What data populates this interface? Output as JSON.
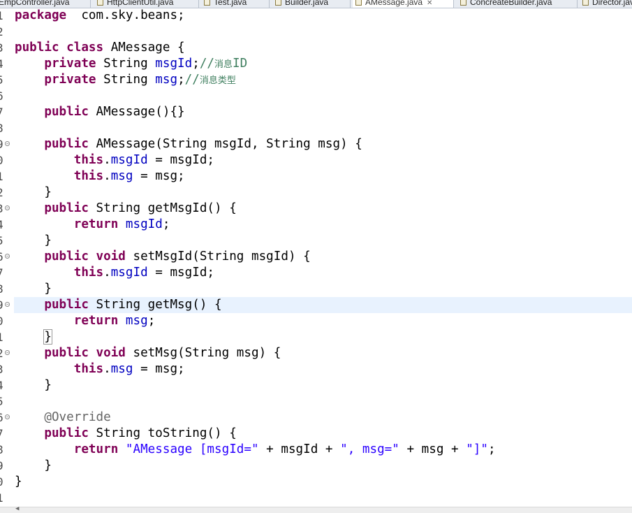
{
  "tabs": [
    {
      "label": "EmpController.java",
      "active": false
    },
    {
      "label": "HttpClientUtil.java",
      "active": false
    },
    {
      "label": "Test.java",
      "active": false
    },
    {
      "label": "Builder.java",
      "active": false
    },
    {
      "label": "AMessage.java",
      "active": true
    },
    {
      "label": "ConcreateBuilder.java",
      "active": false
    },
    {
      "label": "Director.java",
      "active": false
    }
  ],
  "editor": {
    "current_line": 19,
    "lines": [
      {
        "n": "1",
        "fold": "",
        "tokens": [
          [
            "kw",
            "package"
          ],
          [
            "",
            "  com.sky.beans;"
          ]
        ]
      },
      {
        "n": "2",
        "fold": "",
        "tokens": []
      },
      {
        "n": "3",
        "fold": "",
        "tokens": [
          [
            "kw",
            "public"
          ],
          [
            "",
            " "
          ],
          [
            "kw",
            "class"
          ],
          [
            "",
            " AMessage {"
          ]
        ]
      },
      {
        "n": "4",
        "fold": "",
        "tokens": [
          [
            "",
            "    "
          ],
          [
            "kw",
            "private"
          ],
          [
            "",
            " String "
          ],
          [
            "fld",
            "msgId"
          ],
          [
            "",
            ";"
          ],
          [
            "cmt",
            "//"
          ],
          [
            "cmt cjk",
            "消息"
          ],
          [
            "cmt",
            "ID"
          ]
        ]
      },
      {
        "n": "5",
        "fold": "",
        "tokens": [
          [
            "",
            "    "
          ],
          [
            "kw",
            "private"
          ],
          [
            "",
            " String "
          ],
          [
            "fld",
            "msg"
          ],
          [
            "",
            ";"
          ],
          [
            "cmt",
            "//"
          ],
          [
            "cmt cjk",
            "消息类型"
          ]
        ]
      },
      {
        "n": "6",
        "fold": "",
        "tokens": []
      },
      {
        "n": "7",
        "fold": "",
        "tokens": [
          [
            "",
            "    "
          ],
          [
            "kw",
            "public"
          ],
          [
            "",
            " AMessage(){}"
          ]
        ]
      },
      {
        "n": "8",
        "fold": "",
        "tokens": []
      },
      {
        "n": "9",
        "fold": "⊖",
        "tokens": [
          [
            "",
            "    "
          ],
          [
            "kw",
            "public"
          ],
          [
            "",
            " AMessage(String msgId, String msg) {"
          ]
        ]
      },
      {
        "n": "0",
        "fold": "",
        "tokens": [
          [
            "",
            "        "
          ],
          [
            "kw",
            "this"
          ],
          [
            "",
            "."
          ],
          [
            "fld",
            "msgId"
          ],
          [
            "",
            " = msgId;"
          ]
        ]
      },
      {
        "n": "1",
        "fold": "",
        "tokens": [
          [
            "",
            "        "
          ],
          [
            "kw",
            "this"
          ],
          [
            "",
            "."
          ],
          [
            "fld",
            "msg"
          ],
          [
            "",
            " = msg;"
          ]
        ]
      },
      {
        "n": "2",
        "fold": "",
        "tokens": [
          [
            "",
            "    }"
          ]
        ]
      },
      {
        "n": "3",
        "fold": "⊖",
        "tokens": [
          [
            "",
            "    "
          ],
          [
            "kw",
            "public"
          ],
          [
            "",
            " String getMsgId() {"
          ]
        ]
      },
      {
        "n": "4",
        "fold": "",
        "tokens": [
          [
            "",
            "        "
          ],
          [
            "kw",
            "return"
          ],
          [
            "",
            " "
          ],
          [
            "fld",
            "msgId"
          ],
          [
            "",
            ";"
          ]
        ]
      },
      {
        "n": "5",
        "fold": "",
        "tokens": [
          [
            "",
            "    }"
          ]
        ]
      },
      {
        "n": "6",
        "fold": "⊖",
        "tokens": [
          [
            "",
            "    "
          ],
          [
            "kw",
            "public"
          ],
          [
            "",
            " "
          ],
          [
            "kw",
            "void"
          ],
          [
            "",
            " setMsgId(String msgId) {"
          ]
        ]
      },
      {
        "n": "7",
        "fold": "",
        "tokens": [
          [
            "",
            "        "
          ],
          [
            "kw",
            "this"
          ],
          [
            "",
            "."
          ],
          [
            "fld",
            "msgId"
          ],
          [
            "",
            " = msgId;"
          ]
        ]
      },
      {
        "n": "8",
        "fold": "",
        "tokens": [
          [
            "",
            "    }"
          ]
        ]
      },
      {
        "n": "9",
        "fold": "⊖",
        "tokens": [
          [
            "",
            "    "
          ],
          [
            "kw",
            "public"
          ],
          [
            "",
            " String getMsg() {"
          ]
        ]
      },
      {
        "n": "0",
        "fold": "",
        "tokens": [
          [
            "",
            "        "
          ],
          [
            "kw",
            "return"
          ],
          [
            "",
            " "
          ],
          [
            "fld",
            "msg"
          ],
          [
            "",
            ";"
          ]
        ]
      },
      {
        "n": "1",
        "fold": "",
        "tokens": [
          [
            "",
            "    "
          ],
          [
            "brk",
            "}"
          ]
        ]
      },
      {
        "n": "2",
        "fold": "⊖",
        "tokens": [
          [
            "",
            "    "
          ],
          [
            "kw",
            "public"
          ],
          [
            "",
            " "
          ],
          [
            "kw",
            "void"
          ],
          [
            "",
            " setMsg(String msg) {"
          ]
        ]
      },
      {
        "n": "3",
        "fold": "",
        "tokens": [
          [
            "",
            "        "
          ],
          [
            "kw",
            "this"
          ],
          [
            "",
            "."
          ],
          [
            "fld",
            "msg"
          ],
          [
            "",
            " = msg;"
          ]
        ]
      },
      {
        "n": "4",
        "fold": "",
        "tokens": [
          [
            "",
            "    }"
          ]
        ]
      },
      {
        "n": "5",
        "fold": "",
        "tokens": []
      },
      {
        "n": "6",
        "fold": "⊖",
        "tokens": [
          [
            "",
            "    "
          ],
          [
            "ann",
            "@Override"
          ]
        ]
      },
      {
        "n": "7",
        "fold": "",
        "tokens": [
          [
            "",
            "    "
          ],
          [
            "kw",
            "public"
          ],
          [
            "",
            " String toString() {"
          ]
        ]
      },
      {
        "n": "8",
        "fold": "",
        "tokens": [
          [
            "",
            "        "
          ],
          [
            "kw",
            "return"
          ],
          [
            "",
            " "
          ],
          [
            "str",
            "\"AMessage [msgId=\""
          ],
          [
            "",
            " + msgId + "
          ],
          [
            "str",
            "\", msg=\""
          ],
          [
            "",
            " + msg + "
          ],
          [
            "str",
            "\"]\""
          ],
          [
            "",
            ";"
          ]
        ]
      },
      {
        "n": "9",
        "fold": "",
        "tokens": [
          [
            "",
            "    }"
          ]
        ]
      },
      {
        "n": "0",
        "fold": "",
        "tokens": [
          [
            "",
            "}"
          ]
        ]
      },
      {
        "n": "1",
        "fold": "",
        "tokens": []
      }
    ]
  },
  "colors": {
    "keyword": "#7f0055",
    "field": "#0000c0",
    "string": "#2a00ff",
    "comment": "#3f7f5f",
    "annotation": "#646464",
    "current_line_bg": "#e8f2fe"
  },
  "icons": {
    "tab_file": "java-file-icon",
    "tab_close": "close-icon",
    "fold": "fold-collapse-icon",
    "scroll_left": "scroll-left-arrow-icon"
  }
}
